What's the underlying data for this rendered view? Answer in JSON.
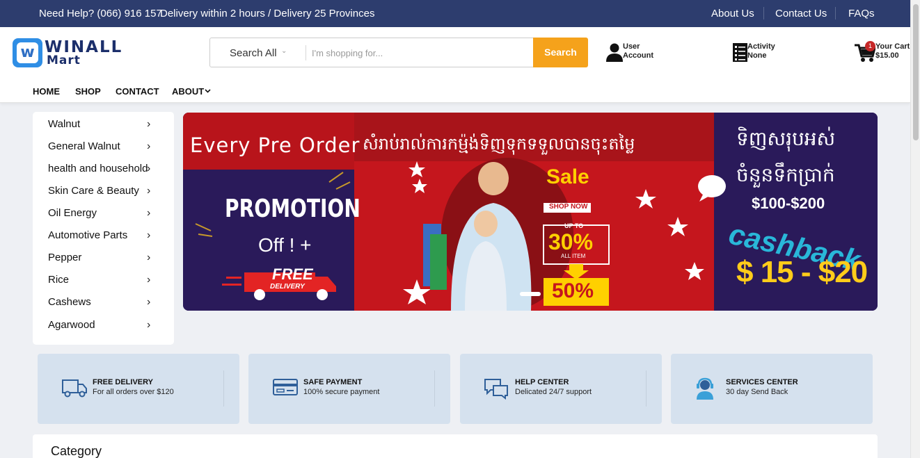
{
  "topbar": {
    "help": "Need Help? (066) 916 157",
    "delivery": "Delivery within 2 hours / Delivery 25 Provinces",
    "links": [
      "About Us",
      "Contact Us",
      "FAQs"
    ]
  },
  "logo": {
    "mark": "w",
    "line1": "WINALL",
    "line2": "Mart"
  },
  "search": {
    "category": "Search All",
    "placeholder": "I'm shopping for...",
    "button": "Search"
  },
  "header": {
    "user": {
      "line1": "User",
      "line2": "Account",
      "icon": "user-icon"
    },
    "activity": {
      "line1": "Activity",
      "line2": "None",
      "icon": "list-icon"
    },
    "cart": {
      "line1": "Your Cart",
      "line2": "$15.00",
      "count": "1",
      "icon": "cart-icon"
    }
  },
  "nav": [
    "HOME",
    "SHOP",
    "CONTACT",
    "ABOUT"
  ],
  "sidebar": {
    "items": [
      "Walnut",
      "General Walnut",
      "health and household",
      "Skin Care & Beauty",
      "Oil Energy",
      "Automotive Parts",
      "Pepper",
      "Rice",
      "Cashews",
      "Agarwood"
    ]
  },
  "banner": {
    "headline": "Every Pre Order",
    "khmer_top": "សំរាប់រាល់ការកម្ម៉ង់ទិញទុកទទួលបានចុះតម្លៃ",
    "khmer_right1": "ទិញសរុបអស់",
    "khmer_right2": "ចំនួនទឹកប្រាក់",
    "range": "$100-$200",
    "promotion": "PROMOTION",
    "off": "Off ! +",
    "free": "FREE",
    "free_sub": "DELIVERY",
    "sale": "Sale",
    "shop_now": "SHOP NOW",
    "up_to": "UP TO",
    "pct1": "30%",
    "all_item": "ALL ITEM",
    "pct2": "50%",
    "cashback": "cashback",
    "cashback_range": "$ 15 - $20"
  },
  "features": [
    {
      "title": "FREE DELIVERY",
      "sub": "For all orders over $120",
      "icon": "truck-icon"
    },
    {
      "title": "SAFE PAYMENT",
      "sub": "100% secure payment",
      "icon": "card-icon"
    },
    {
      "title": "HELP CENTER",
      "sub": "Delicated 24/7 support",
      "icon": "chat-icon"
    },
    {
      "title": "SERVICES CENTER",
      "sub": "30 day Send Back",
      "icon": "headset-icon"
    }
  ],
  "category": {
    "title": "Category"
  },
  "colors": {
    "topbar": "#2d3d6e",
    "accent": "#f5a21b",
    "feature_bg": "#d5e1ee",
    "banner_red": "#c5161d"
  }
}
